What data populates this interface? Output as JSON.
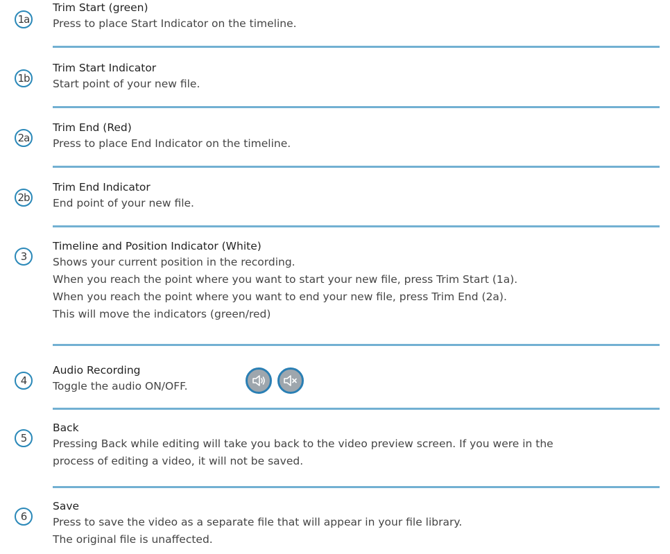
{
  "items": [
    {
      "badge": "1a",
      "title": "Trim Start (green)",
      "lines": [
        "Press to place Start Indicator on the timeline."
      ]
    },
    {
      "badge": "1b",
      "title": "Trim Start Indicator",
      "lines": [
        "Start point of your new file."
      ]
    },
    {
      "badge": "2a",
      "title": "Trim End (Red)",
      "lines": [
        "Press to place End Indicator on the timeline."
      ]
    },
    {
      "badge": "2b",
      "title": "Trim End Indicator",
      "lines": [
        "End point of your new file."
      ]
    },
    {
      "badge": "3",
      "title": "Timeline and Position Indicator (White)",
      "lines": [
        "Shows your current position in the recording.",
        "When you reach the point where you want to start your new file, press Trim Start (1a).",
        "When you reach the point where you want to end your new file, press Trim End (2a).",
        "This will move the indicators (green/red)"
      ]
    },
    {
      "badge": "4",
      "title": "Audio Recording",
      "lines": [
        "Toggle the audio ON/OFF."
      ],
      "icons": [
        "speaker-on-icon",
        "speaker-muted-icon"
      ]
    },
    {
      "badge": "5",
      "title": "Back",
      "lines": [
        "Pressing Back while editing will take you back to the video preview screen. If you were in the",
        "process of editing a video, it will not be saved."
      ]
    },
    {
      "badge": "6",
      "title": "Save",
      "lines": [
        "Press to save the video as a separate file that will appear in your file library.",
        "The original file is unaffected."
      ]
    }
  ],
  "colors": {
    "accent": "#2a88b8",
    "rule": "#72b0d2",
    "icon_fill": "#9ea6ad"
  }
}
